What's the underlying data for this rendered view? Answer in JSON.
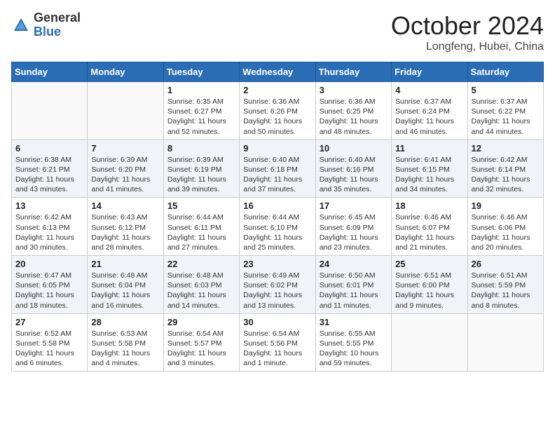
{
  "header": {
    "logo_general": "General",
    "logo_blue": "Blue",
    "month_title": "October 2024",
    "location": "Longfeng, Hubei, China"
  },
  "weekdays": [
    "Sunday",
    "Monday",
    "Tuesday",
    "Wednesday",
    "Thursday",
    "Friday",
    "Saturday"
  ],
  "weeks": [
    [
      {
        "day": "",
        "info": ""
      },
      {
        "day": "",
        "info": ""
      },
      {
        "day": "1",
        "info": "Sunrise: 6:35 AM\nSunset: 6:27 PM\nDaylight: 11 hours and 52 minutes."
      },
      {
        "day": "2",
        "info": "Sunrise: 6:36 AM\nSunset: 6:26 PM\nDaylight: 11 hours and 50 minutes."
      },
      {
        "day": "3",
        "info": "Sunrise: 6:36 AM\nSunset: 6:25 PM\nDaylight: 11 hours and 48 minutes."
      },
      {
        "day": "4",
        "info": "Sunrise: 6:37 AM\nSunset: 6:24 PM\nDaylight: 11 hours and 46 minutes."
      },
      {
        "day": "5",
        "info": "Sunrise: 6:37 AM\nSunset: 6:22 PM\nDaylight: 11 hours and 44 minutes."
      }
    ],
    [
      {
        "day": "6",
        "info": "Sunrise: 6:38 AM\nSunset: 6:21 PM\nDaylight: 11 hours and 43 minutes."
      },
      {
        "day": "7",
        "info": "Sunrise: 6:39 AM\nSunset: 6:20 PM\nDaylight: 11 hours and 41 minutes."
      },
      {
        "day": "8",
        "info": "Sunrise: 6:39 AM\nSunset: 6:19 PM\nDaylight: 11 hours and 39 minutes."
      },
      {
        "day": "9",
        "info": "Sunrise: 6:40 AM\nSunset: 6:18 PM\nDaylight: 11 hours and 37 minutes."
      },
      {
        "day": "10",
        "info": "Sunrise: 6:40 AM\nSunset: 6:16 PM\nDaylight: 11 hours and 35 minutes."
      },
      {
        "day": "11",
        "info": "Sunrise: 6:41 AM\nSunset: 6:15 PM\nDaylight: 11 hours and 34 minutes."
      },
      {
        "day": "12",
        "info": "Sunrise: 6:42 AM\nSunset: 6:14 PM\nDaylight: 11 hours and 32 minutes."
      }
    ],
    [
      {
        "day": "13",
        "info": "Sunrise: 6:42 AM\nSunset: 6:13 PM\nDaylight: 11 hours and 30 minutes."
      },
      {
        "day": "14",
        "info": "Sunrise: 6:43 AM\nSunset: 6:12 PM\nDaylight: 11 hours and 28 minutes."
      },
      {
        "day": "15",
        "info": "Sunrise: 6:44 AM\nSunset: 6:11 PM\nDaylight: 11 hours and 27 minutes."
      },
      {
        "day": "16",
        "info": "Sunrise: 6:44 AM\nSunset: 6:10 PM\nDaylight: 11 hours and 25 minutes."
      },
      {
        "day": "17",
        "info": "Sunrise: 6:45 AM\nSunset: 6:09 PM\nDaylight: 11 hours and 23 minutes."
      },
      {
        "day": "18",
        "info": "Sunrise: 6:46 AM\nSunset: 6:07 PM\nDaylight: 11 hours and 21 minutes."
      },
      {
        "day": "19",
        "info": "Sunrise: 6:46 AM\nSunset: 6:06 PM\nDaylight: 11 hours and 20 minutes."
      }
    ],
    [
      {
        "day": "20",
        "info": "Sunrise: 6:47 AM\nSunset: 6:05 PM\nDaylight: 11 hours and 18 minutes."
      },
      {
        "day": "21",
        "info": "Sunrise: 6:48 AM\nSunset: 6:04 PM\nDaylight: 11 hours and 16 minutes."
      },
      {
        "day": "22",
        "info": "Sunrise: 6:48 AM\nSunset: 6:03 PM\nDaylight: 11 hours and 14 minutes."
      },
      {
        "day": "23",
        "info": "Sunrise: 6:49 AM\nSunset: 6:02 PM\nDaylight: 11 hours and 13 minutes."
      },
      {
        "day": "24",
        "info": "Sunrise: 6:50 AM\nSunset: 6:01 PM\nDaylight: 11 hours and 11 minutes."
      },
      {
        "day": "25",
        "info": "Sunrise: 6:51 AM\nSunset: 6:00 PM\nDaylight: 11 hours and 9 minutes."
      },
      {
        "day": "26",
        "info": "Sunrise: 6:51 AM\nSunset: 5:59 PM\nDaylight: 11 hours and 8 minutes."
      }
    ],
    [
      {
        "day": "27",
        "info": "Sunrise: 6:52 AM\nSunset: 5:58 PM\nDaylight: 11 hours and 6 minutes."
      },
      {
        "day": "28",
        "info": "Sunrise: 6:53 AM\nSunset: 5:58 PM\nDaylight: 11 hours and 4 minutes."
      },
      {
        "day": "29",
        "info": "Sunrise: 6:54 AM\nSunset: 5:57 PM\nDaylight: 11 hours and 3 minutes."
      },
      {
        "day": "30",
        "info": "Sunrise: 6:54 AM\nSunset: 5:56 PM\nDaylight: 11 hours and 1 minute."
      },
      {
        "day": "31",
        "info": "Sunrise: 6:55 AM\nSunset: 5:55 PM\nDaylight: 10 hours and 59 minutes."
      },
      {
        "day": "",
        "info": ""
      },
      {
        "day": "",
        "info": ""
      }
    ]
  ]
}
